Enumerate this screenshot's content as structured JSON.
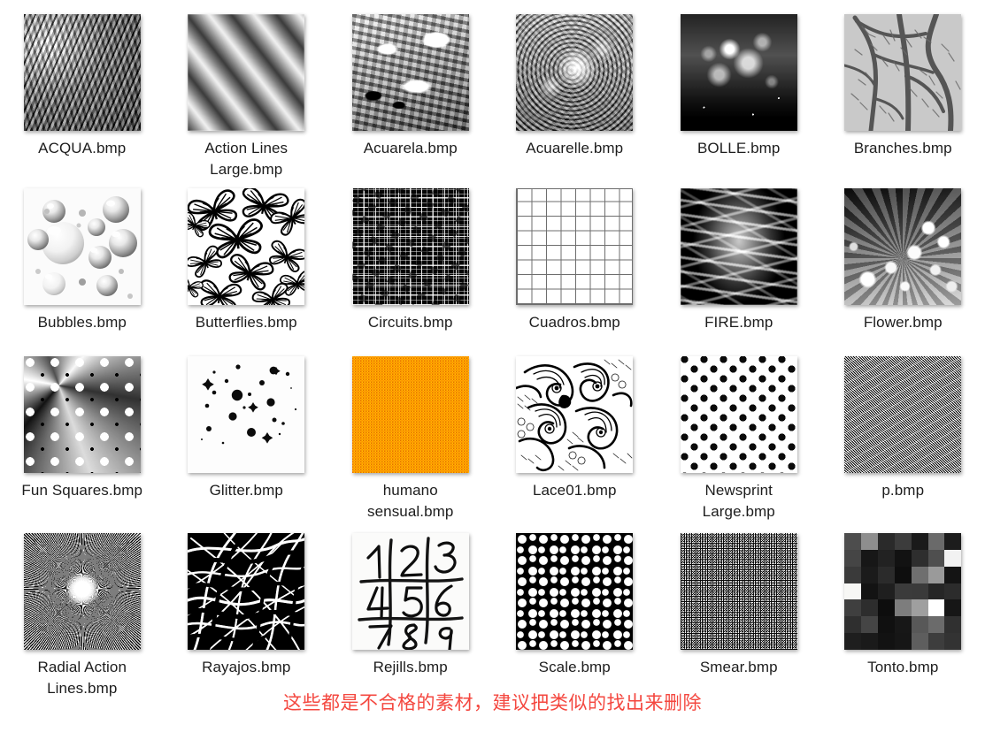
{
  "page": {
    "background_color": "#ffffff",
    "label_color": "#1d1d1d",
    "caption_color": "#f4473f",
    "columns": 6,
    "rows": 4
  },
  "caption": {
    "text": "这些都是不合格的素材，建议把类似的找出来删除"
  },
  "files": [
    {
      "name": "ACQUA.bmp",
      "texture": "grayscale-bark-ripple",
      "colors": [
        "#8a8a8a",
        "#3a3a3a",
        "#d9d9d9"
      ]
    },
    {
      "name": "Action Lines Large.bmp",
      "texture": "diagonal-gray-bands",
      "colors": [
        "#3a3a3a",
        "#f2f2f2"
      ]
    },
    {
      "name": "Acuarela.bmp",
      "texture": "watercolor-blotches-gray",
      "colors": [
        "#9a9a9a",
        "#141414",
        "#fdfdfd"
      ]
    },
    {
      "name": "Acuarelle.bmp",
      "texture": "cloudy-mottled-gray",
      "colors": [
        "#7b7b7b",
        "#ffffff",
        "#4f4f4f"
      ]
    },
    {
      "name": "BOLLE.bmp",
      "texture": "smoke-clouds-on-black",
      "colors": [
        "#0c0c0c",
        "#ffffff"
      ]
    },
    {
      "name": "Branches.bmp",
      "texture": "bare-tree-branches",
      "colors": [
        "#c8c8c8",
        "#3a3a3a"
      ]
    },
    {
      "name": "Bubbles.bmp",
      "texture": "glossy-gray-bubbles",
      "colors": [
        "#fbfbfb",
        "#9b9b9b"
      ]
    },
    {
      "name": "Butterflies.bmp",
      "texture": "butterfly-outlines",
      "colors": [
        "#ffffff",
        "#000000"
      ]
    },
    {
      "name": "Circuits.bmp",
      "texture": "circuit-traces-on-black",
      "colors": [
        "#050505",
        "#ffffff"
      ]
    },
    {
      "name": "Cuadros.bmp",
      "texture": "thin-grid-8x8",
      "colors": [
        "#ffffff",
        "#6e6e6e"
      ]
    },
    {
      "name": "FIRE.bmp",
      "texture": "grayscale-flames",
      "colors": [
        "#1d1d1d",
        "#b9b9b9"
      ]
    },
    {
      "name": "Flower.bmp",
      "texture": "chrysanthemum-bush-gray",
      "colors": [
        "#2c2c2c",
        "#fafafa"
      ]
    },
    {
      "name": "Fun Squares.bmp",
      "texture": "circles-diamonds-swirl",
      "colors": [
        "#9b9b9b",
        "#ffffff",
        "#111111"
      ]
    },
    {
      "name": "Glitter.bmp",
      "texture": "scattered-dots-diamonds",
      "colors": [
        "#fdfdfd",
        "#000000"
      ]
    },
    {
      "name": "humano sensual.bmp",
      "texture": "orange-noise",
      "colors": [
        "#f5a000",
        "#ff8c00",
        "#ffc400"
      ]
    },
    {
      "name": "Lace01.bmp",
      "texture": "lace-line-art",
      "colors": [
        "#ffffff",
        "#000000"
      ]
    },
    {
      "name": "Newsprint Large.bmp",
      "texture": "polka-dots-black",
      "colors": [
        "#ffffff",
        "#0a0a0a"
      ]
    },
    {
      "name": "p.bmp",
      "texture": "woven-moire-mesh",
      "colors": [
        "#cfcfcf",
        "#000000"
      ]
    },
    {
      "name": "Radial Action Lines.bmp",
      "texture": "radial-starburst",
      "colors": [
        "#111111",
        "#ffffff"
      ]
    },
    {
      "name": "Rayajos.bmp",
      "texture": "chaotic-brush-strokes",
      "colors": [
        "#ffffff",
        "#000000"
      ]
    },
    {
      "name": "Rejills.bmp",
      "texture": "handdrawn-sudoku-grid",
      "colors": [
        "#fbfbfa",
        "#111111"
      ],
      "digits": [
        "1",
        "2",
        "3",
        "4",
        "5",
        "6",
        "7",
        "8",
        "9"
      ]
    },
    {
      "name": "Scale.bmp",
      "texture": "white-cells-on-black",
      "colors": [
        "#0b0b0b",
        "#fdfdfd"
      ]
    },
    {
      "name": "Smear.bmp",
      "texture": "white-grain-spray-on-black",
      "colors": [
        "#0a0a0a",
        "#ffffff"
      ]
    },
    {
      "name": "Tonto.bmp",
      "texture": "dark-gray-checker-7x7",
      "colors": [
        "#222222",
        "#ffffff"
      ]
    }
  ]
}
